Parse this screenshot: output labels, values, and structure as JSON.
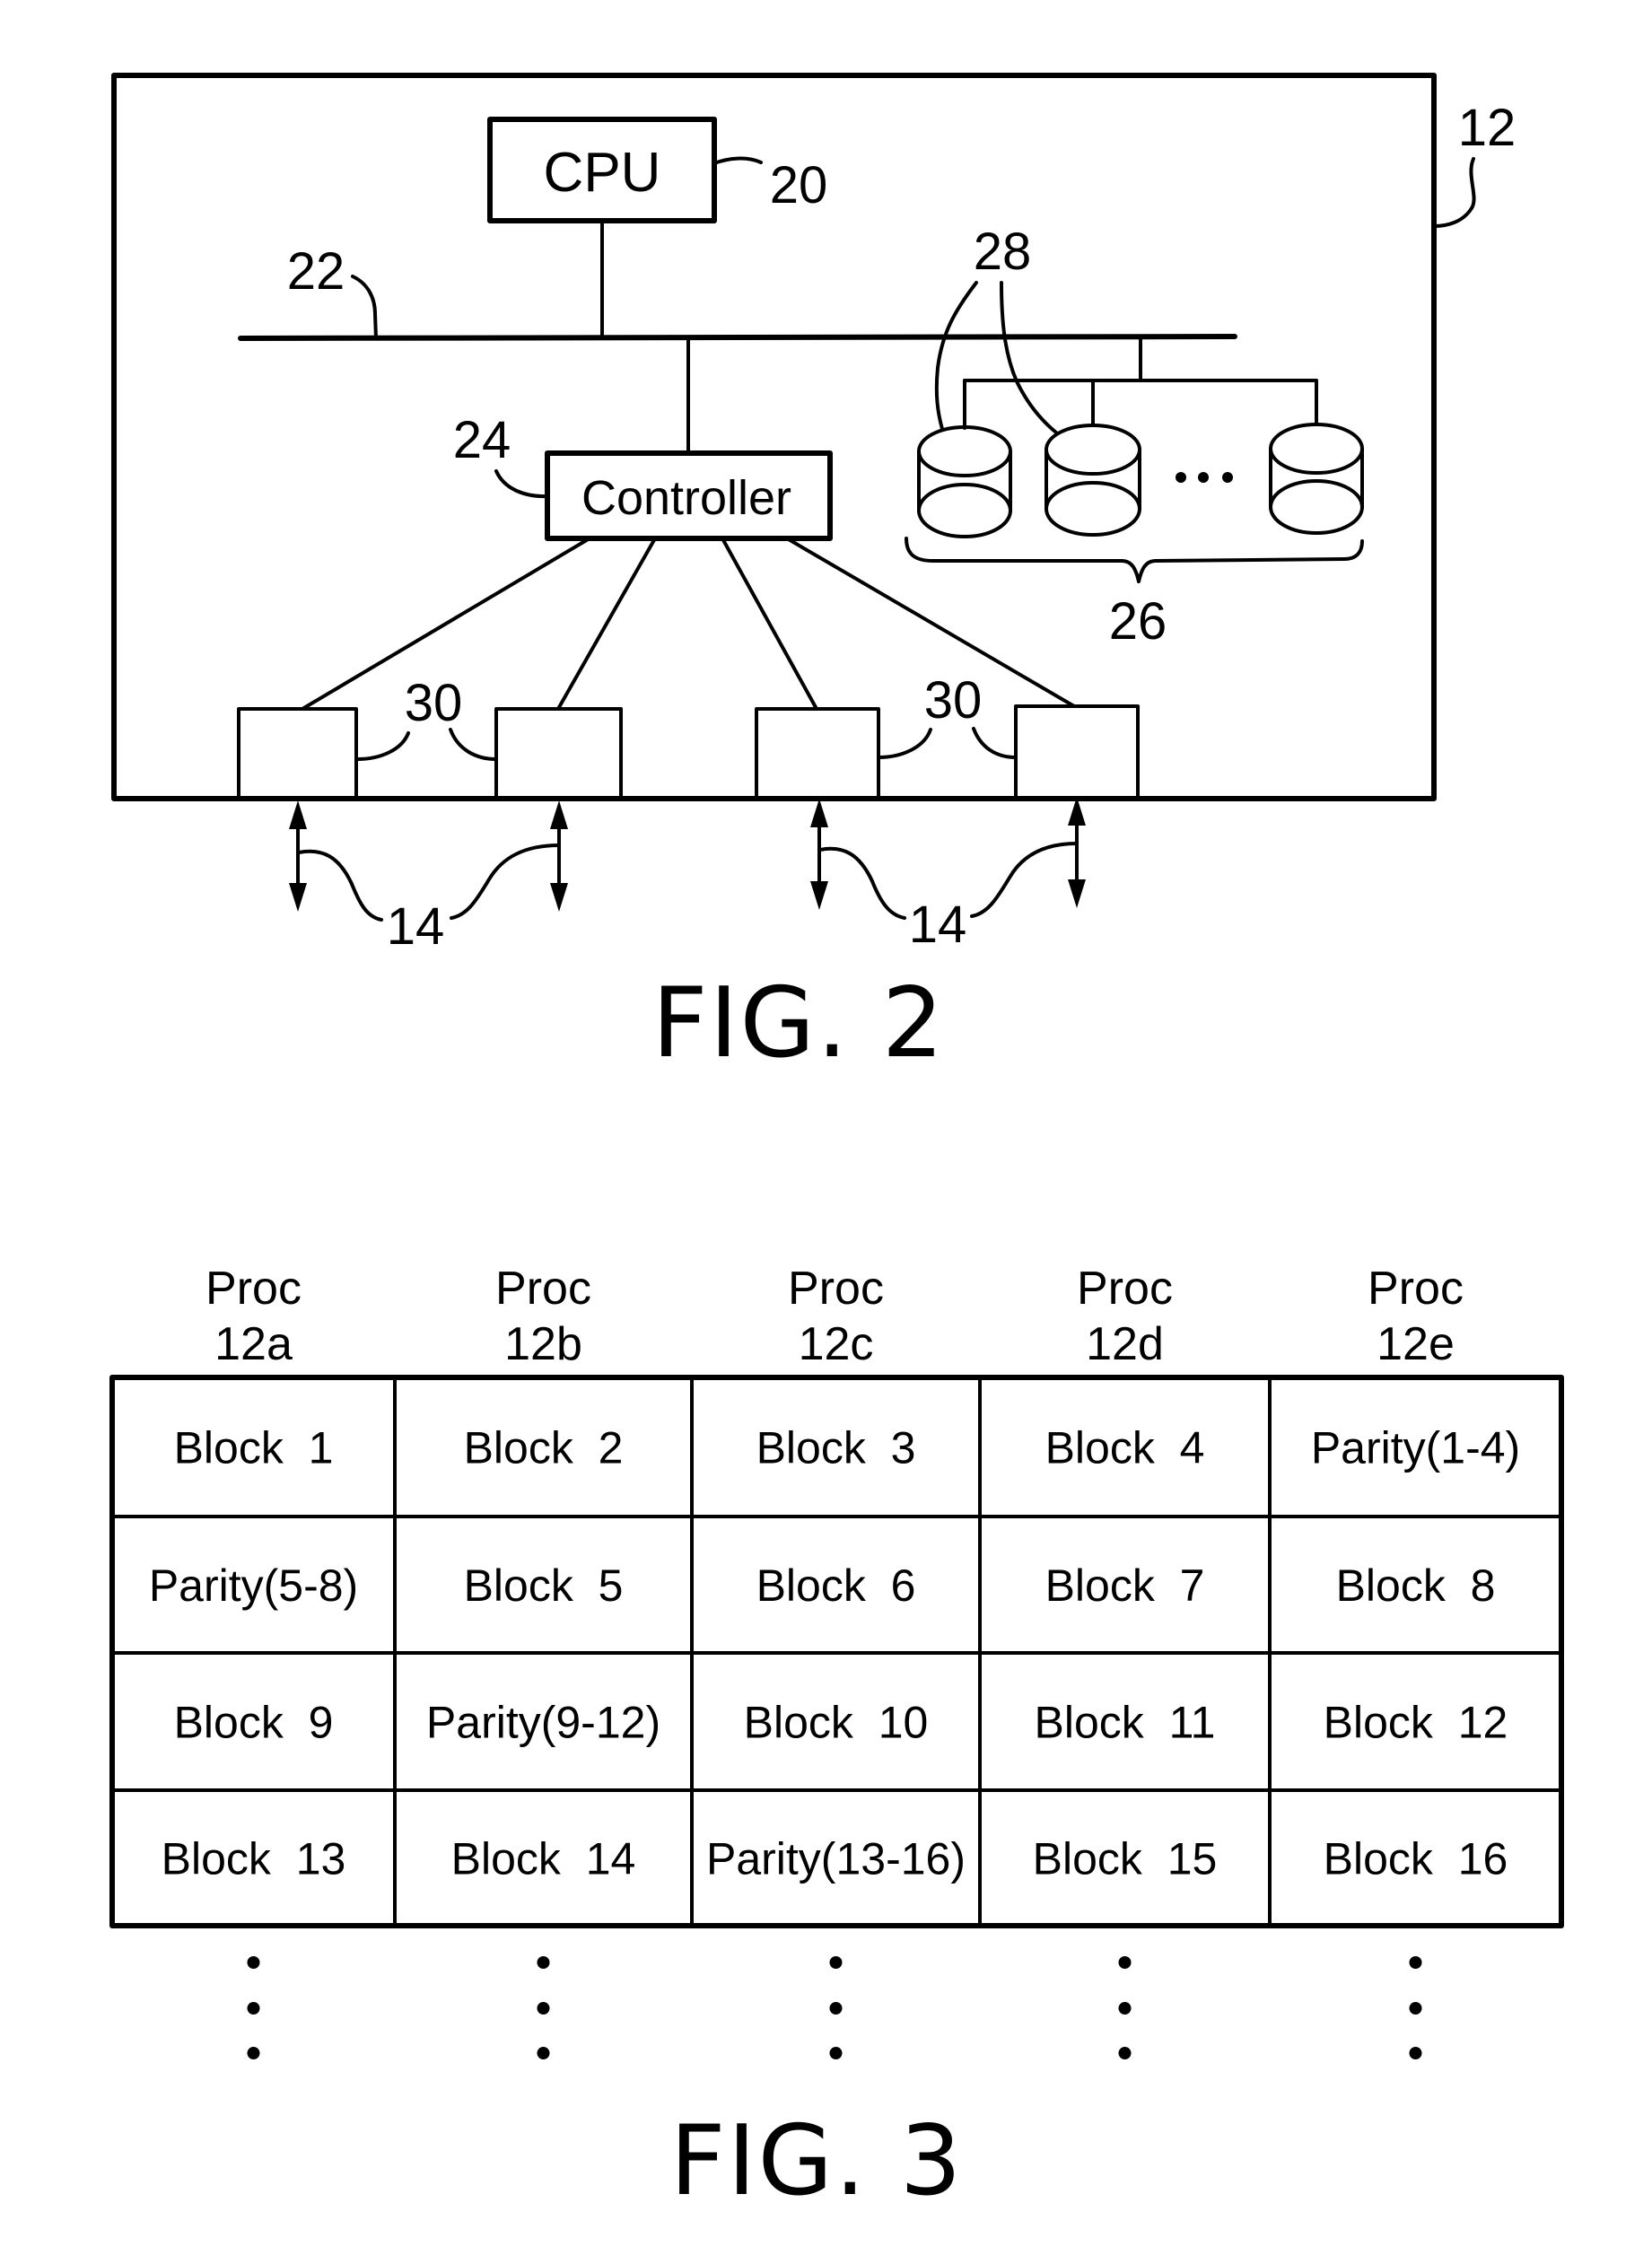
{
  "fig2": {
    "caption": "FIG. 2",
    "cpu": {
      "label": "CPU",
      "ref": "20"
    },
    "bus_ref": "22",
    "controller": {
      "label": "Controller",
      "ref": "24"
    },
    "processor_ref": "12",
    "disk_array_ref": "26",
    "disk_ref": "28",
    "port_ref_left": "30",
    "port_ref_right": "30",
    "link_ref_left": "14",
    "link_ref_right": "14",
    "disk_ellipsis": "..."
  },
  "fig3": {
    "caption": "FIG. 3",
    "columns": [
      {
        "line1": "Proc",
        "line2": "12a"
      },
      {
        "line1": "Proc",
        "line2": "12b"
      },
      {
        "line1": "Proc",
        "line2": "12c"
      },
      {
        "line1": "Proc",
        "line2": "12d"
      },
      {
        "line1": "Proc",
        "line2": "12e"
      }
    ],
    "rows": [
      [
        "Block  1",
        "Block  2",
        "Block  3",
        "Block  4",
        "Parity(1-4)"
      ],
      [
        "Parity(5-8)",
        "Block  5",
        "Block  6",
        "Block  7",
        "Block  8"
      ],
      [
        "Block  9",
        "Parity(9-12)",
        "Block  10",
        "Block  11",
        "Block  12"
      ],
      [
        "Block  13",
        "Block  14",
        "Parity(13-16)",
        "Block  15",
        "Block  16"
      ]
    ],
    "continuation": "⋮"
  }
}
